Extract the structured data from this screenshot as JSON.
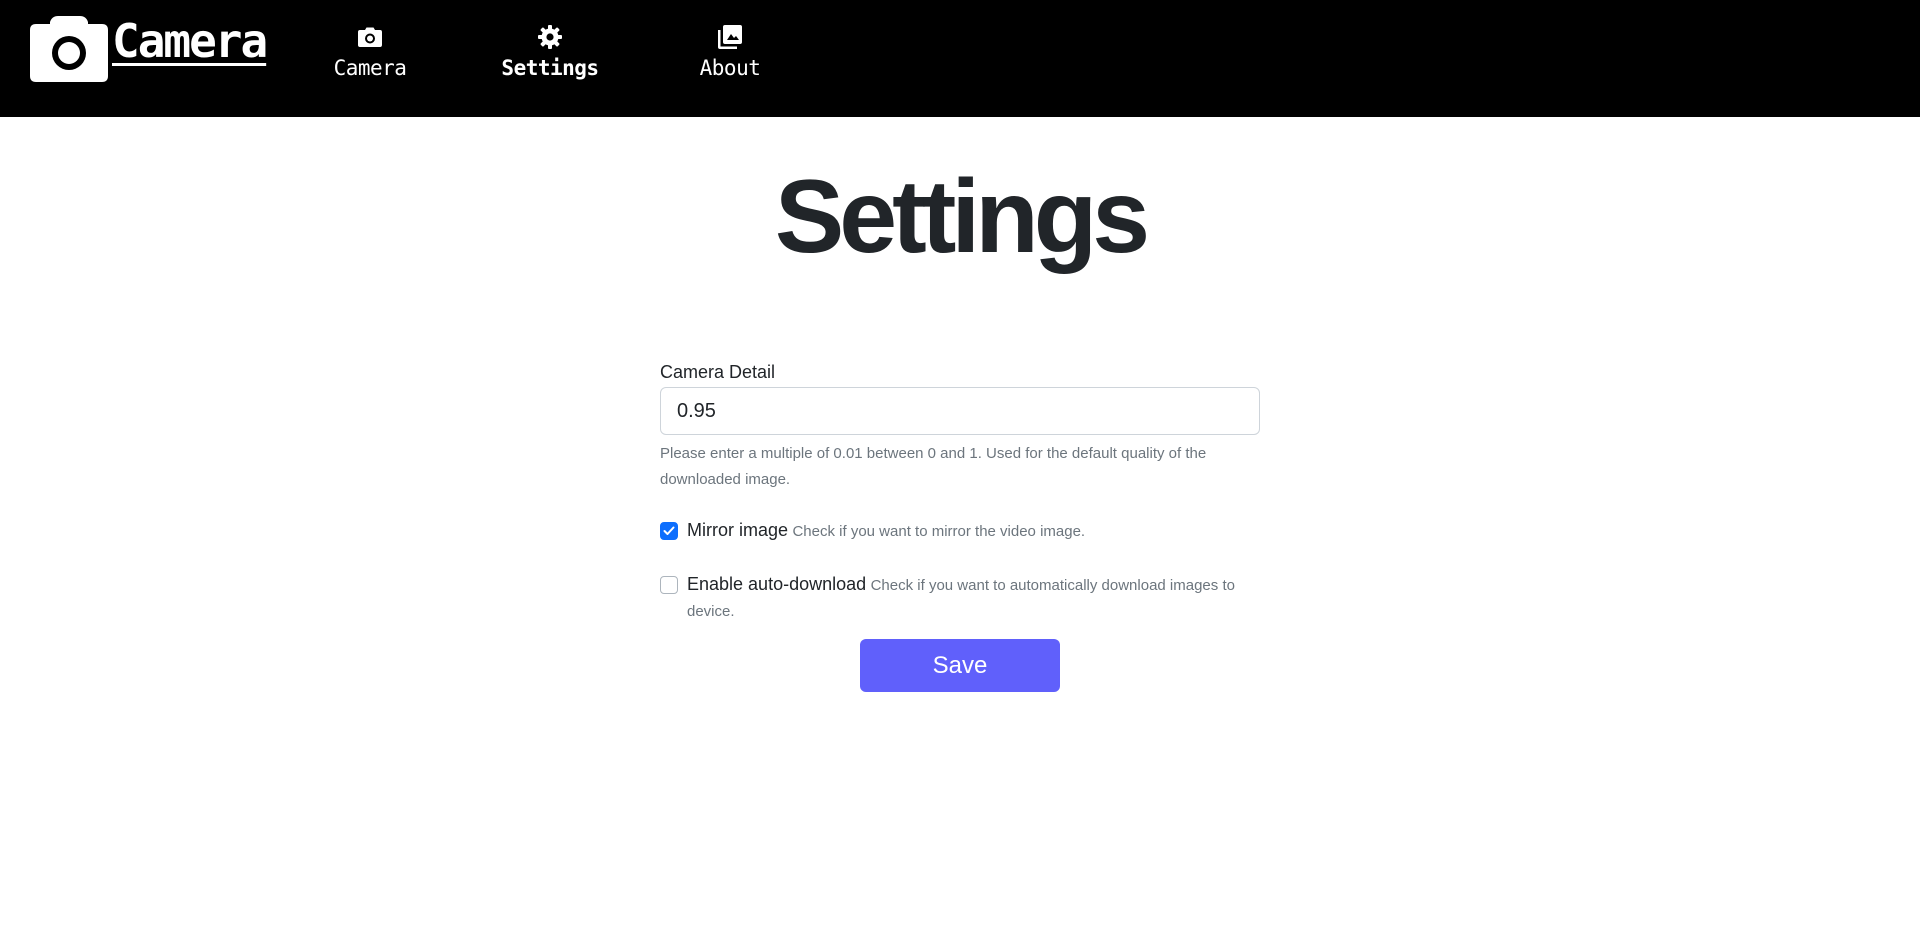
{
  "colors": {
    "header_bg": "#000000",
    "title_text": "#212529",
    "muted_text": "#6c757d",
    "checkbox_checked": "#0d6efd",
    "save_button_bg": "#6060fb"
  },
  "header": {
    "brand": {
      "icon": "camera-icon",
      "title": "Camera"
    },
    "nav": [
      {
        "label": "Camera",
        "icon": "camera-icon",
        "active": false
      },
      {
        "label": "Settings",
        "icon": "gear-icon",
        "active": true
      },
      {
        "label": "About",
        "icon": "photo-library-icon",
        "active": false
      }
    ]
  },
  "main": {
    "title": "Settings",
    "form": {
      "camera_detail": {
        "label": "Camera Detail",
        "value": "0.95",
        "help": "Please enter a multiple of 0.01 between 0 and 1. Used for the default quality of the downloaded image."
      },
      "mirror_image": {
        "label": "Mirror image",
        "help": "Check if you want to mirror the video image.",
        "checked": true
      },
      "auto_download": {
        "label": "Enable auto-download",
        "help": "Check if you want to automatically download images to device.",
        "checked": false
      },
      "save_label": "Save"
    }
  }
}
